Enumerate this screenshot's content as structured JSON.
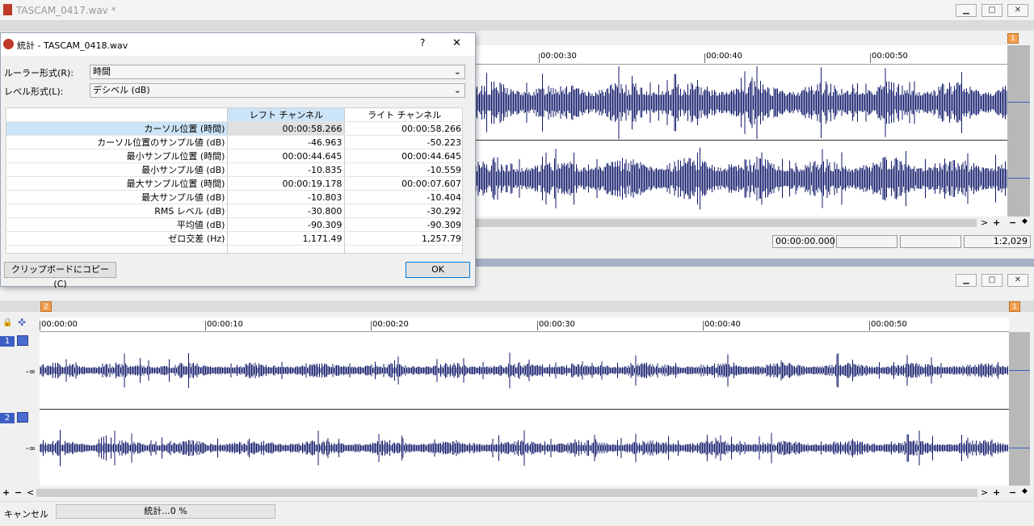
{
  "win1": {
    "title": "TASCAM_0417.wav *",
    "ruler_ticks": [
      "00:00:30",
      "00:00:40",
      "00:00:50"
    ],
    "marker": "1",
    "status": {
      "position": "00:00:00.000",
      "field2": "",
      "field3": "",
      "zoom": "1:2,029"
    },
    "scroll": {
      "right": ">",
      "plus": "+",
      "minus": "−",
      "arrows": "◆"
    }
  },
  "dialog": {
    "title": "統計 - TASCAM_0418.wav",
    "help": "?",
    "close": "✕",
    "ruler_label": "ルーラー形式(R):",
    "ruler_value": "時間",
    "level_label": "レベル形式(L):",
    "level_value": "デシベル (dB)",
    "headers": [
      "レフト チャンネル",
      "ライト チャンネル"
    ],
    "rows": [
      {
        "label": "カーソル位置 (時間)",
        "left": "00:00:58.266",
        "right": "00:00:58.266"
      },
      {
        "label": "カーソル位置のサンプル値 (dB)",
        "left": "-46.963",
        "right": "-50.223"
      },
      {
        "label": "最小サンプル位置 (時間)",
        "left": "00:00:44.645",
        "right": "00:00:44.645"
      },
      {
        "label": "最小サンプル値 (dB)",
        "left": "-10.835",
        "right": "-10.559"
      },
      {
        "label": "最大サンプル位置 (時間)",
        "left": "00:00:19.178",
        "right": "00:00:07.607"
      },
      {
        "label": "最大サンプル値 (dB)",
        "left": "-10.803",
        "right": "-10.404"
      },
      {
        "label": "RMS レベル (dB)",
        "left": "-30.800",
        "right": "-30.292"
      },
      {
        "label": "平均値 (dB)",
        "left": "-90.309",
        "right": "-90.309"
      },
      {
        "label": "ゼロ交差 (Hz)",
        "left": "1,171.49",
        "right": "1,257.79"
      }
    ],
    "copy_button": "クリップボードにコピー(C)",
    "ok_button": "OK"
  },
  "win2": {
    "ruler_ticks": [
      "00:00:00",
      "00:00:10",
      "00:00:20",
      "00:00:30",
      "00:00:40",
      "00:00:50"
    ],
    "marker_left": "2",
    "marker_right": "1",
    "ch1": "1",
    "ch2": "2",
    "db1": "-∞",
    "db2": "-∞",
    "scroll": {
      "left_plus": "+",
      "left_minus": "−",
      "left_arrow": "<",
      "right": ">",
      "plus": "+",
      "minus": "−",
      "arrows": "◆"
    }
  },
  "statusbar": {
    "cancel": "キャンセル",
    "progress": "統計...0 %"
  },
  "colors": {
    "wave": "#101a6a",
    "accent": "#3d5fc4",
    "marker": "#f0a050"
  }
}
